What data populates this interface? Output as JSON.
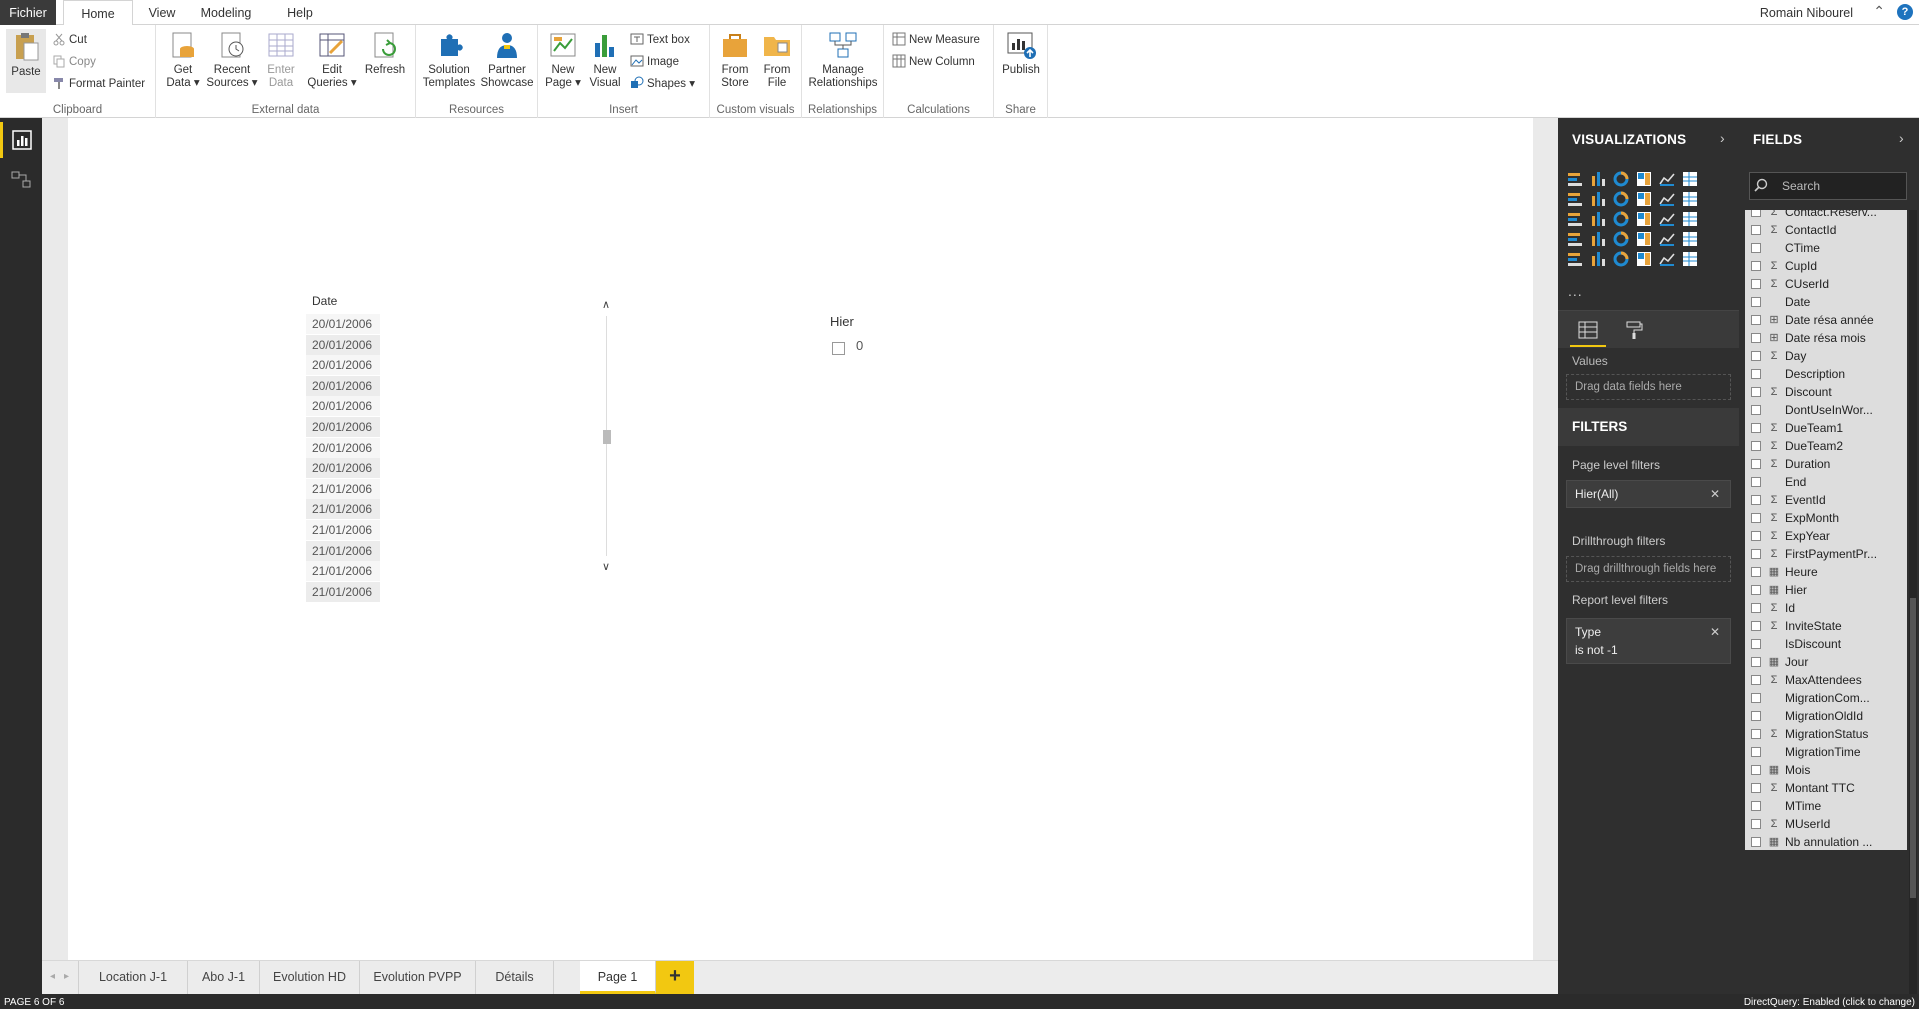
{
  "menubar": {
    "tabs": [
      "Fichier",
      "Home",
      "View",
      "Modeling",
      "Help"
    ],
    "user": "Romain Nibourel",
    "help": "?"
  },
  "ribbon": {
    "clipboard": {
      "paste": "Paste",
      "cut": "Cut",
      "copy": "Copy",
      "format_painter": "Format Painter",
      "label": "Clipboard"
    },
    "external_data": {
      "get_data": [
        "Get",
        "Data ▾"
      ],
      "recent_sources": [
        "Recent",
        "Sources ▾"
      ],
      "enter_data": [
        "Enter",
        "Data"
      ],
      "edit_queries": [
        "Edit",
        "Queries ▾"
      ],
      "refresh": "Refresh",
      "label": "External data"
    },
    "resources": {
      "solution_templates": [
        "Solution",
        "Templates"
      ],
      "partner_showcase": [
        "Partner",
        "Showcase"
      ],
      "label": "Resources"
    },
    "insert": {
      "new_page": [
        "New",
        "Page ▾"
      ],
      "new_visual": [
        "New",
        "Visual"
      ],
      "text_box": "Text box",
      "image": "Image",
      "shapes": "Shapes ▾",
      "label": "Insert"
    },
    "custom_visuals": {
      "from_store": [
        "From",
        "Store"
      ],
      "from_file": [
        "From",
        "File"
      ],
      "label": "Custom visuals"
    },
    "relationships": {
      "manage": [
        "Manage",
        "Relationships"
      ],
      "label": "Relationships"
    },
    "calculations": {
      "new_measure": "New Measure",
      "new_column": "New Column",
      "label": "Calculations"
    },
    "share": {
      "publish": "Publish",
      "label": "Share"
    }
  },
  "table_visual": {
    "header": "Date",
    "rows": [
      "20/01/2006",
      "20/01/2006",
      "20/01/2006",
      "20/01/2006",
      "20/01/2006",
      "20/01/2006",
      "20/01/2006",
      "20/01/2006",
      "21/01/2006",
      "21/01/2006",
      "21/01/2006",
      "21/01/2006",
      "21/01/2006",
      "21/01/2006"
    ]
  },
  "slicer": {
    "title": "Hier",
    "value": "0"
  },
  "page_tabs": {
    "tabs": [
      "Location J-1",
      "Abo J-1",
      "Evolution HD",
      "Evolution PVPP",
      "Détails",
      "Page 1"
    ],
    "active": "Page 1",
    "add": "+"
  },
  "statusbar": {
    "page": "PAGE 6 OF 6",
    "directquery": "DirectQuery: Enabled (click to change)"
  },
  "visualizations": {
    "title": "VISUALIZATIONS",
    "more": "...",
    "values_label": "Values",
    "values_drop": "Drag data fields here"
  },
  "filters": {
    "title": "FILTERS",
    "page_level": "Page level filters",
    "page_filter": "Hier(All)",
    "drillthrough": "Drillthrough filters",
    "drillthrough_drop": "Drag drillthrough fields here",
    "report_level": "Report level filters",
    "report_filter_name": "Type",
    "report_filter_cond": "is not -1",
    "close": "✕"
  },
  "fields": {
    "title": "FIELDS",
    "search_placeholder": "Search",
    "items": [
      {
        "name": "Contact.Reserv...",
        "sym": "Σ"
      },
      {
        "name": "ContactId",
        "sym": "Σ"
      },
      {
        "name": "CTime",
        "sym": ""
      },
      {
        "name": "CupId",
        "sym": "Σ"
      },
      {
        "name": "CUserId",
        "sym": "Σ"
      },
      {
        "name": "Date",
        "sym": ""
      },
      {
        "name": "Date résa année",
        "sym": "⊞"
      },
      {
        "name": "Date résa mois",
        "sym": "⊞"
      },
      {
        "name": "Day",
        "sym": "Σ"
      },
      {
        "name": "Description",
        "sym": ""
      },
      {
        "name": "Discount",
        "sym": "Σ"
      },
      {
        "name": "DontUseInWor...",
        "sym": ""
      },
      {
        "name": "DueTeam1",
        "sym": "Σ"
      },
      {
        "name": "DueTeam2",
        "sym": "Σ"
      },
      {
        "name": "Duration",
        "sym": "Σ"
      },
      {
        "name": "End",
        "sym": ""
      },
      {
        "name": "EventId",
        "sym": "Σ"
      },
      {
        "name": "ExpMonth",
        "sym": "Σ"
      },
      {
        "name": "ExpYear",
        "sym": "Σ"
      },
      {
        "name": "FirstPaymentPr...",
        "sym": "Σ"
      },
      {
        "name": "Heure",
        "sym": "▦"
      },
      {
        "name": "Hier",
        "sym": "▦"
      },
      {
        "name": "Id",
        "sym": "Σ"
      },
      {
        "name": "InviteState",
        "sym": "Σ"
      },
      {
        "name": "IsDiscount",
        "sym": ""
      },
      {
        "name": "Jour",
        "sym": "▦"
      },
      {
        "name": "MaxAttendees",
        "sym": "Σ"
      },
      {
        "name": "MigrationCom...",
        "sym": ""
      },
      {
        "name": "MigrationOldId",
        "sym": ""
      },
      {
        "name": "MigrationStatus",
        "sym": "Σ"
      },
      {
        "name": "MigrationTime",
        "sym": ""
      },
      {
        "name": "Mois",
        "sym": "▦"
      },
      {
        "name": "Montant TTC",
        "sym": "Σ"
      },
      {
        "name": "MTime",
        "sym": ""
      },
      {
        "name": "MUserId",
        "sym": "Σ"
      },
      {
        "name": "Nb annulation ...",
        "sym": "▦"
      }
    ]
  },
  "colors": {
    "accent": "#f2c811",
    "pane": "#2f2f2f",
    "canvas_bg": "#eaeaea"
  }
}
